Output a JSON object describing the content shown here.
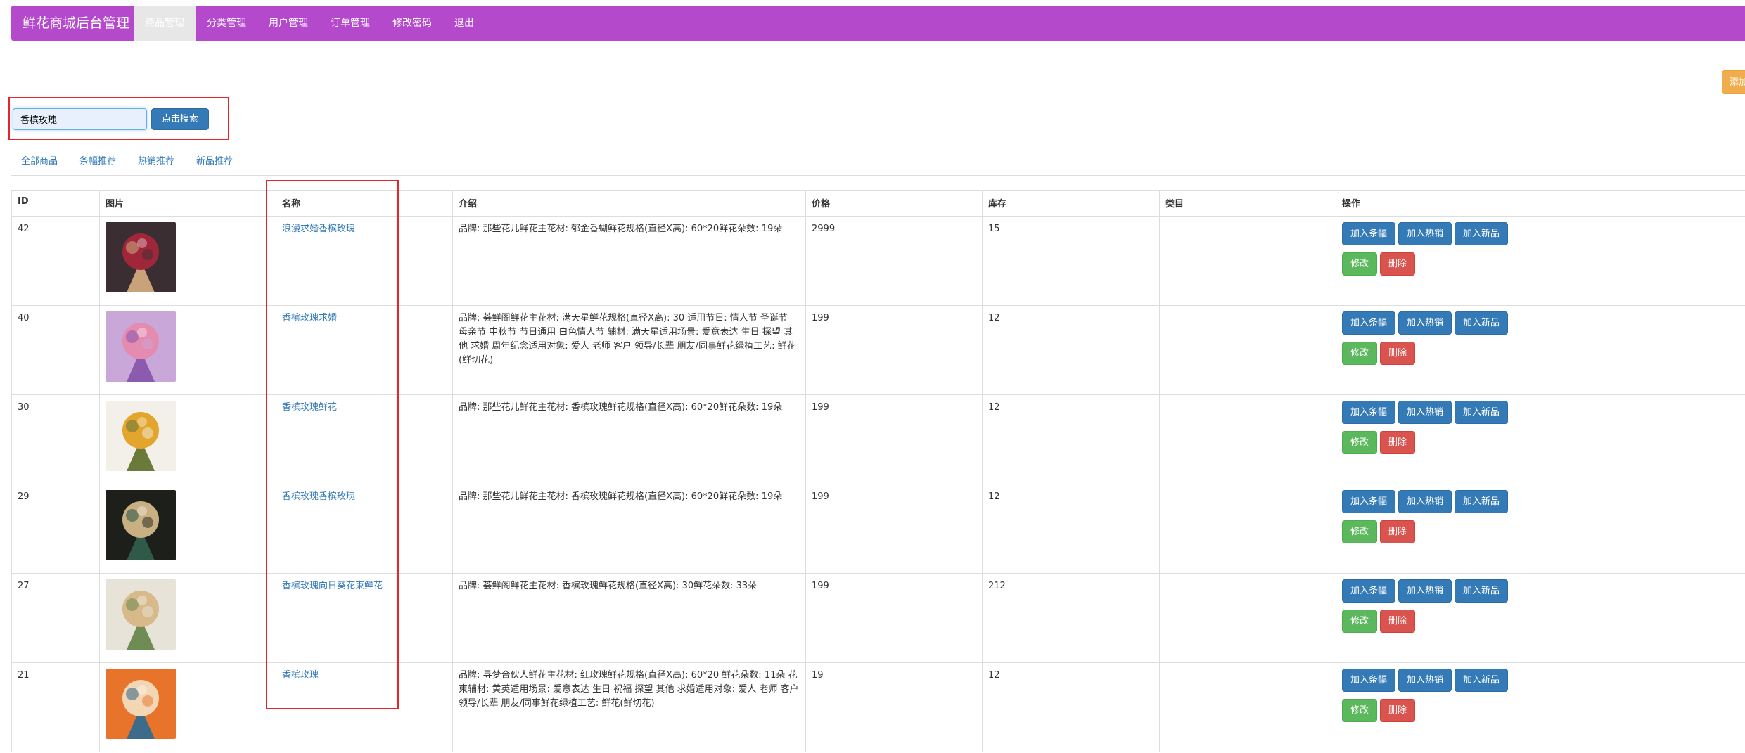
{
  "navbar": {
    "brand": "鲜花商城后台管理",
    "items": [
      "商品管理",
      "分类管理",
      "用户管理",
      "订单管理",
      "修改密码",
      "退出"
    ]
  },
  "add_button_label": "添加",
  "search": {
    "value": "香槟玫瑰",
    "button_label": "点击搜索"
  },
  "filters": [
    "全部商品",
    "条幅推荐",
    "热销推荐",
    "新品推荐"
  ],
  "table": {
    "headers": [
      "ID",
      "图片",
      "名称",
      "介绍",
      "价格",
      "库存",
      "类目",
      "操作"
    ],
    "rows": [
      {
        "id": "42",
        "name": "浪漫求婚香槟玫瑰",
        "desc": "品牌: 那些花儿鲜花主花材: 郁金香蝴鲜花规格(直径X高): 60*20鲜花朵数: 19朵",
        "price": "2999",
        "stock": "15",
        "category": ""
      },
      {
        "id": "40",
        "name": "香槟玫瑰求婚",
        "desc": "品牌: 荟鲜阁鲜花主花材: 满天星鲜花规格(直径X高): 30 适用节日: 情人节 圣诞节 母亲节 中秋节 节日通用 白色情人节 辅材: 满天星适用场景: 爱意表达 生日 探望 其他 求婚 周年纪念适用对象: 爱人 老师 客户 领导/长辈 朋友/同事鲜花绿植工艺: 鲜花(鲜切花)",
        "price": "199",
        "stock": "12",
        "category": ""
      },
      {
        "id": "30",
        "name": "香槟玫瑰鲜花",
        "desc": "品牌: 那些花儿鲜花主花材: 香槟玫瑰鲜花规格(直径X高): 60*20鲜花朵数: 19朵",
        "price": "199",
        "stock": "12",
        "category": ""
      },
      {
        "id": "29",
        "name": "香槟玫瑰香槟玫瑰",
        "desc": "品牌: 那些花儿鲜花主花材: 香槟玫瑰鲜花规格(直径X高): 60*20鲜花朵数: 19朵",
        "price": "199",
        "stock": "12",
        "category": ""
      },
      {
        "id": "27",
        "name": "香槟玫瑰向日葵花束鲜花",
        "desc": "品牌: 荟鲜阁鲜花主花材: 香槟玫瑰鲜花规格(直径X高): 30鲜花朵数: 33朵",
        "price": "199",
        "stock": "212",
        "category": ""
      },
      {
        "id": "21",
        "name": "香槟玫瑰",
        "desc": "品牌: 寻梦合伙人鲜花主花材: 红玫瑰鲜花规格(直径X高): 60*20 鲜花朵数: 11朵 花束辅材: 黄英适用场景: 爱意表达 生日 祝福 探望 其他 求婚适用对象: 爱人 老师 客户 领导/长辈 朋友/同事鲜花绿植工艺: 鲜花(鲜切花)",
        "price": "19",
        "stock": "12",
        "category": ""
      }
    ],
    "actions": {
      "banner": "加入条幅",
      "hot": "加入热销",
      "new": "加入新品",
      "edit": "修改",
      "delete": "删除"
    }
  },
  "thumb_colors": [
    [
      "#3a2e33",
      "#a0263a",
      "#c9a27a"
    ],
    [
      "#c9a7d8",
      "#e48bb0",
      "#8c5bb0"
    ],
    [
      "#f2f0e8",
      "#e3a52c",
      "#6a7a3a"
    ],
    [
      "#1c1f1a",
      "#c9b083",
      "#2f5a4a"
    ],
    [
      "#e7e3d8",
      "#d8b98a",
      "#6f8c55"
    ],
    [
      "#e8742b",
      "#f3d6b3",
      "#3d6b8a"
    ]
  ]
}
